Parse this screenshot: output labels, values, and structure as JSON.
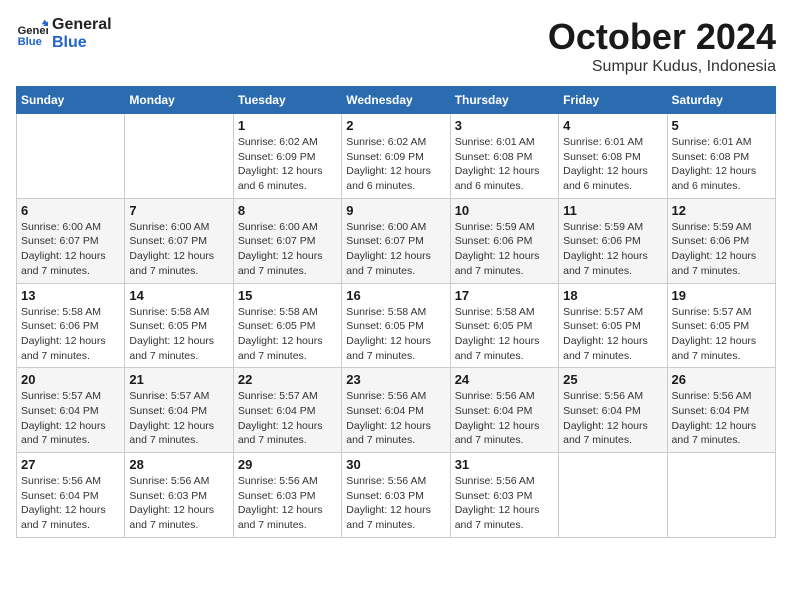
{
  "logo": {
    "text_general": "General",
    "text_blue": "Blue"
  },
  "title": "October 2024",
  "location": "Sumpur Kudus, Indonesia",
  "weekdays": [
    "Sunday",
    "Monday",
    "Tuesday",
    "Wednesday",
    "Thursday",
    "Friday",
    "Saturday"
  ],
  "weeks": [
    [
      {
        "day": "",
        "info": ""
      },
      {
        "day": "",
        "info": ""
      },
      {
        "day": "1",
        "info": "Sunrise: 6:02 AM\nSunset: 6:09 PM\nDaylight: 12 hours and 6 minutes."
      },
      {
        "day": "2",
        "info": "Sunrise: 6:02 AM\nSunset: 6:09 PM\nDaylight: 12 hours and 6 minutes."
      },
      {
        "day": "3",
        "info": "Sunrise: 6:01 AM\nSunset: 6:08 PM\nDaylight: 12 hours and 6 minutes."
      },
      {
        "day": "4",
        "info": "Sunrise: 6:01 AM\nSunset: 6:08 PM\nDaylight: 12 hours and 6 minutes."
      },
      {
        "day": "5",
        "info": "Sunrise: 6:01 AM\nSunset: 6:08 PM\nDaylight: 12 hours and 6 minutes."
      }
    ],
    [
      {
        "day": "6",
        "info": "Sunrise: 6:00 AM\nSunset: 6:07 PM\nDaylight: 12 hours and 7 minutes."
      },
      {
        "day": "7",
        "info": "Sunrise: 6:00 AM\nSunset: 6:07 PM\nDaylight: 12 hours and 7 minutes."
      },
      {
        "day": "8",
        "info": "Sunrise: 6:00 AM\nSunset: 6:07 PM\nDaylight: 12 hours and 7 minutes."
      },
      {
        "day": "9",
        "info": "Sunrise: 6:00 AM\nSunset: 6:07 PM\nDaylight: 12 hours and 7 minutes."
      },
      {
        "day": "10",
        "info": "Sunrise: 5:59 AM\nSunset: 6:06 PM\nDaylight: 12 hours and 7 minutes."
      },
      {
        "day": "11",
        "info": "Sunrise: 5:59 AM\nSunset: 6:06 PM\nDaylight: 12 hours and 7 minutes."
      },
      {
        "day": "12",
        "info": "Sunrise: 5:59 AM\nSunset: 6:06 PM\nDaylight: 12 hours and 7 minutes."
      }
    ],
    [
      {
        "day": "13",
        "info": "Sunrise: 5:58 AM\nSunset: 6:06 PM\nDaylight: 12 hours and 7 minutes."
      },
      {
        "day": "14",
        "info": "Sunrise: 5:58 AM\nSunset: 6:05 PM\nDaylight: 12 hours and 7 minutes."
      },
      {
        "day": "15",
        "info": "Sunrise: 5:58 AM\nSunset: 6:05 PM\nDaylight: 12 hours and 7 minutes."
      },
      {
        "day": "16",
        "info": "Sunrise: 5:58 AM\nSunset: 6:05 PM\nDaylight: 12 hours and 7 minutes."
      },
      {
        "day": "17",
        "info": "Sunrise: 5:58 AM\nSunset: 6:05 PM\nDaylight: 12 hours and 7 minutes."
      },
      {
        "day": "18",
        "info": "Sunrise: 5:57 AM\nSunset: 6:05 PM\nDaylight: 12 hours and 7 minutes."
      },
      {
        "day": "19",
        "info": "Sunrise: 5:57 AM\nSunset: 6:05 PM\nDaylight: 12 hours and 7 minutes."
      }
    ],
    [
      {
        "day": "20",
        "info": "Sunrise: 5:57 AM\nSunset: 6:04 PM\nDaylight: 12 hours and 7 minutes."
      },
      {
        "day": "21",
        "info": "Sunrise: 5:57 AM\nSunset: 6:04 PM\nDaylight: 12 hours and 7 minutes."
      },
      {
        "day": "22",
        "info": "Sunrise: 5:57 AM\nSunset: 6:04 PM\nDaylight: 12 hours and 7 minutes."
      },
      {
        "day": "23",
        "info": "Sunrise: 5:56 AM\nSunset: 6:04 PM\nDaylight: 12 hours and 7 minutes."
      },
      {
        "day": "24",
        "info": "Sunrise: 5:56 AM\nSunset: 6:04 PM\nDaylight: 12 hours and 7 minutes."
      },
      {
        "day": "25",
        "info": "Sunrise: 5:56 AM\nSunset: 6:04 PM\nDaylight: 12 hours and 7 minutes."
      },
      {
        "day": "26",
        "info": "Sunrise: 5:56 AM\nSunset: 6:04 PM\nDaylight: 12 hours and 7 minutes."
      }
    ],
    [
      {
        "day": "27",
        "info": "Sunrise: 5:56 AM\nSunset: 6:04 PM\nDaylight: 12 hours and 7 minutes."
      },
      {
        "day": "28",
        "info": "Sunrise: 5:56 AM\nSunset: 6:03 PM\nDaylight: 12 hours and 7 minutes."
      },
      {
        "day": "29",
        "info": "Sunrise: 5:56 AM\nSunset: 6:03 PM\nDaylight: 12 hours and 7 minutes."
      },
      {
        "day": "30",
        "info": "Sunrise: 5:56 AM\nSunset: 6:03 PM\nDaylight: 12 hours and 7 minutes."
      },
      {
        "day": "31",
        "info": "Sunrise: 5:56 AM\nSunset: 6:03 PM\nDaylight: 12 hours and 7 minutes."
      },
      {
        "day": "",
        "info": ""
      },
      {
        "day": "",
        "info": ""
      }
    ]
  ]
}
